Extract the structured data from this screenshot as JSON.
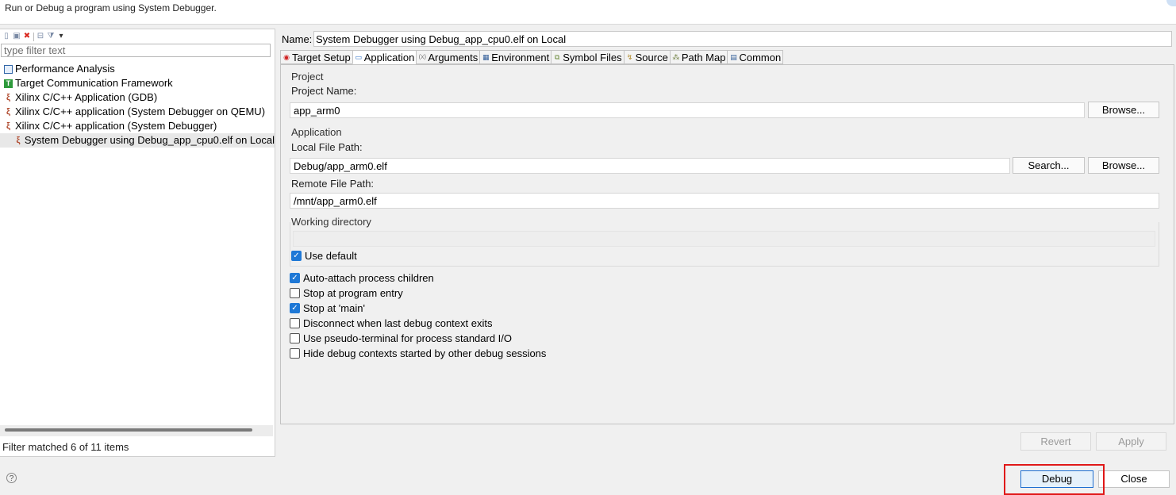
{
  "header": {
    "description": "Run or Debug a program using System Debugger."
  },
  "left": {
    "toolbar_icons": [
      "new-config-icon",
      "duplicate-icon",
      "delete-icon",
      "collapse-all-icon",
      "filter-icon",
      "view-menu-icon"
    ],
    "filter_placeholder": "type filter text",
    "tree": [
      {
        "label": "Performance Analysis",
        "icon": "performance-icon"
      },
      {
        "label": "Target Communication Framework",
        "icon": "tcf-icon"
      },
      {
        "label": "Xilinx C/C++ Application (GDB)",
        "icon": "xilinx-icon"
      },
      {
        "label": "Xilinx C/C++ application (System Debugger on QEMU)",
        "icon": "xilinx-icon"
      },
      {
        "label": "Xilinx C/C++ application (System Debugger)",
        "icon": "xilinx-icon"
      },
      {
        "label": "System Debugger using Debug_app_cpu0.elf on Local",
        "icon": "xilinx-icon",
        "selected": true
      }
    ],
    "status": "Filter matched 6 of 11 items"
  },
  "right": {
    "name_label": "Name:",
    "name_value": "System Debugger using Debug_app_cpu0.elf on Local",
    "tabs": [
      {
        "label": "Target Setup",
        "icon": "target-icon"
      },
      {
        "label": "Application",
        "icon": "application-icon",
        "active": true
      },
      {
        "label": "Arguments",
        "icon": "arguments-icon"
      },
      {
        "label": "Environment",
        "icon": "environment-icon"
      },
      {
        "label": "Symbol Files",
        "icon": "symbol-files-icon"
      },
      {
        "label": "Source",
        "icon": "source-icon"
      },
      {
        "label": "Path Map",
        "icon": "path-map-icon"
      },
      {
        "label": "Common",
        "icon": "common-icon"
      }
    ],
    "project_group": "Project",
    "project_name_label": "Project Name:",
    "project_name_value": "app_arm0",
    "browse_label": "Browse...",
    "application_group": "Application",
    "local_path_label": "Local File Path:",
    "local_path_value": "Debug/app_arm0.elf",
    "search_label": "Search...",
    "remote_path_label": "Remote File Path:",
    "remote_path_value": "/mnt/app_arm0.elf",
    "working_dir_group": "Working directory",
    "use_default_label": "Use default",
    "use_default_checked": true,
    "options": [
      {
        "label": "Auto-attach process children",
        "checked": true
      },
      {
        "label": "Stop at program entry",
        "checked": false
      },
      {
        "label": "Stop at 'main'",
        "checked": true
      },
      {
        "label": "Disconnect when last debug context exits",
        "checked": false
      },
      {
        "label": "Use pseudo-terminal for process standard I/O",
        "checked": false
      },
      {
        "label": "Hide debug contexts started by other debug sessions",
        "checked": false
      }
    ],
    "revert_label": "Revert",
    "apply_label": "Apply"
  },
  "footer": {
    "help_glyph": "?",
    "debug_label": "Debug",
    "close_label": "Close"
  },
  "colors": {
    "accent": "#1e78d6",
    "highlight": "#e01818",
    "selection": "#e8e8e8"
  }
}
